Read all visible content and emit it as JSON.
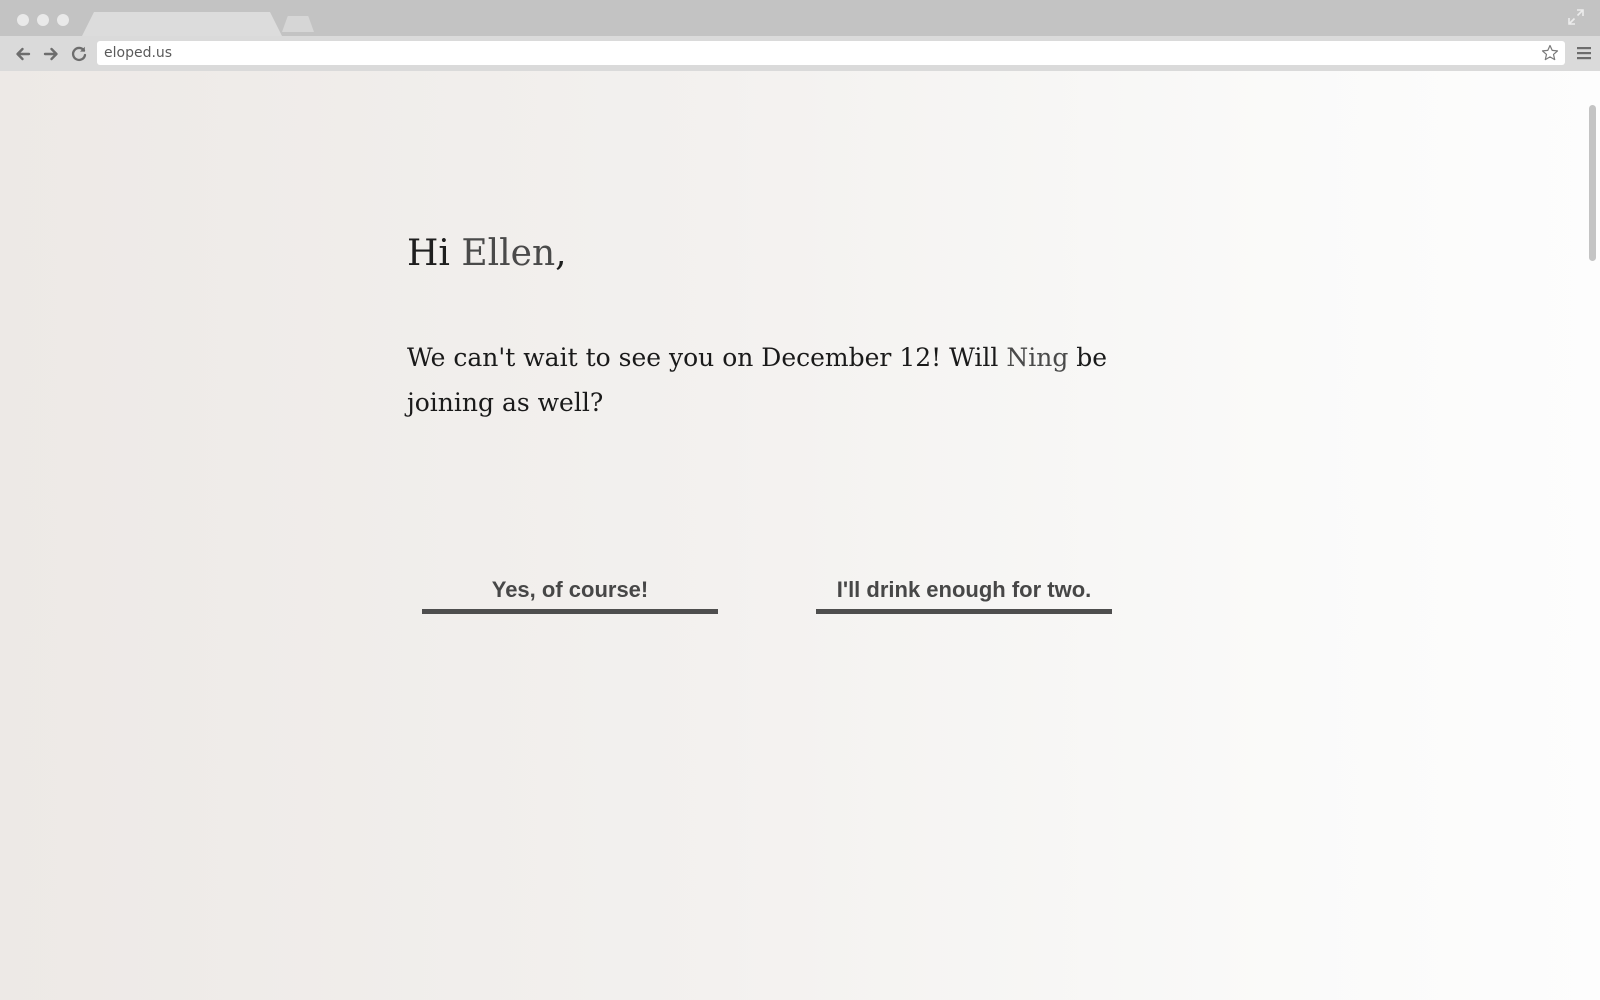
{
  "browser": {
    "url": "eloped.us",
    "tab_title": "",
    "icons": {
      "back": "back-arrow-icon",
      "forward": "forward-arrow-icon",
      "reload": "reload-icon",
      "bookmark": "star-icon",
      "menu": "hamburger-menu-icon",
      "fullscreen": "fullscreen-icon"
    }
  },
  "page": {
    "greeting_prefix": "Hi ",
    "guest_name": "Ellen",
    "greeting_suffix": ",",
    "message_prefix": "We can't wait to see you on December 12! Will ",
    "partner_name": "Ning",
    "message_suffix": " be joining as well?",
    "buttons": {
      "yes_label": "Yes, of course!",
      "no_label": "I'll drink enough for two."
    }
  },
  "colors": {
    "text": "#1e1e1e",
    "name_accent": "#4a4a4a",
    "button_text": "#474747",
    "button_underline": "#4e4e4e"
  }
}
